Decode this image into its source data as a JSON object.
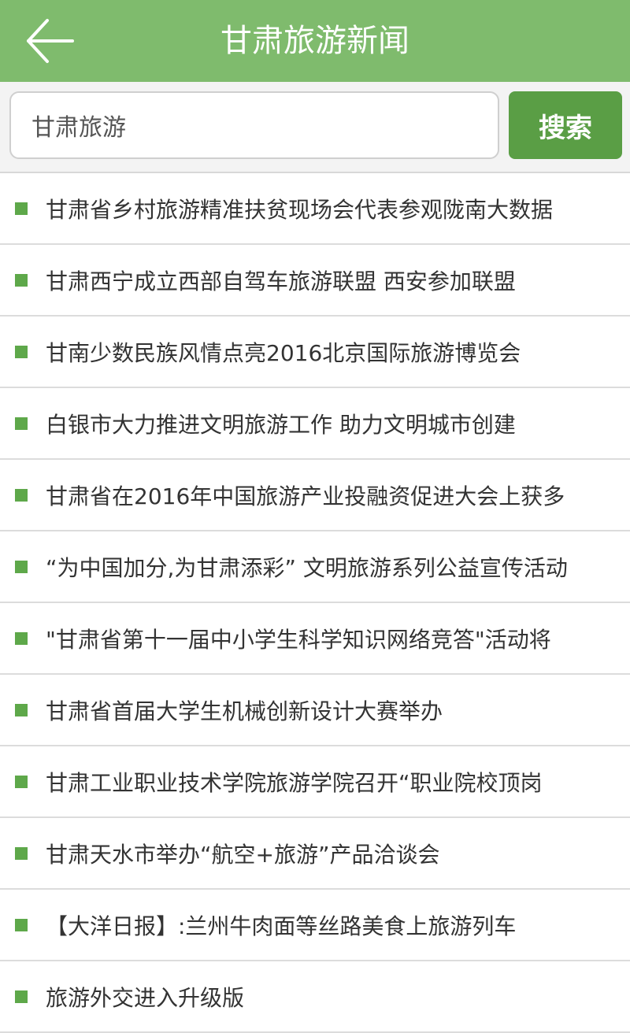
{
  "header": {
    "title": "甘肃旅游新闻",
    "back_icon": "arrow-left-icon",
    "color": "#7fbb6d"
  },
  "search": {
    "value": "甘肃旅游",
    "button_label": "搜索",
    "button_color": "#5a9e45"
  },
  "news": [
    {
      "title": "甘肃省乡村旅游精准扶贫现场会代表参观陇南大数据"
    },
    {
      "title": "甘肃西宁成立西部自驾车旅游联盟 西安参加联盟"
    },
    {
      "title": "甘南少数民族风情点亮2016北京国际旅游博览会"
    },
    {
      "title": "白银市大力推进文明旅游工作 助力文明城市创建"
    },
    {
      "title": "甘肃省在2016年中国旅游产业投融资促进大会上获多"
    },
    {
      "title": "“为中国加分,为甘肃添彩” 文明旅游系列公益宣传活动"
    },
    {
      "title": "\"甘肃省第十一届中小学生科学知识网络竞答\"活动将"
    },
    {
      "title": "甘肃省首届大学生机械创新设计大赛举办"
    },
    {
      "title": "甘肃工业职业技术学院旅游学院召开“职业院校顶岗"
    },
    {
      "title": "甘肃天水市举办“航空+旅游”产品洽谈会"
    },
    {
      "title": "【大洋日报】:兰州牛肉面等丝路美食上旅游列车"
    },
    {
      "title": "旅游外交进入升级版"
    }
  ],
  "bullet_color": "#5ea84a"
}
